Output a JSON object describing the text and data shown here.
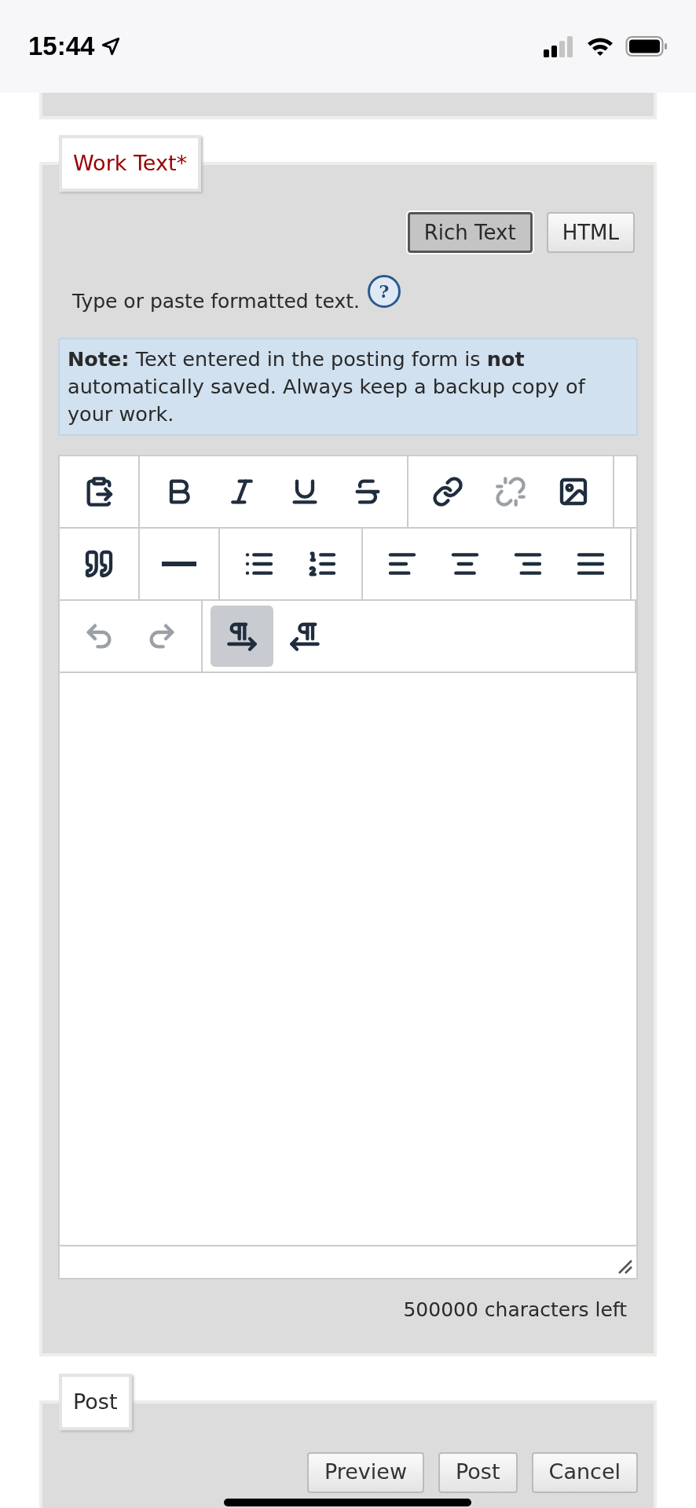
{
  "status_bar": {
    "time": "15:44"
  },
  "work_text": {
    "legend": "Work Text*",
    "modes": [
      {
        "label": "Rich Text",
        "selected": true
      },
      {
        "label": "HTML",
        "selected": false
      }
    ],
    "hint": "Type or paste formatted text.",
    "help": "?",
    "note": "**Note:** Text entered in the posting form is **not** automatically saved. Always keep a backup copy of your work.",
    "toolbar": [
      [
        [
          {
            "kind": "paste",
            "disabled": false
          }
        ],
        [
          {
            "kind": "bold",
            "disabled": false
          },
          {
            "kind": "italic",
            "disabled": false
          },
          {
            "kind": "underline",
            "disabled": false
          },
          {
            "kind": "strike",
            "disabled": false
          }
        ],
        [
          {
            "kind": "link",
            "disabled": false
          },
          {
            "kind": "unlink",
            "disabled": true
          },
          {
            "kind": "image",
            "disabled": false
          }
        ]
      ],
      [
        [
          {
            "kind": "quote",
            "disabled": false
          }
        ],
        [
          {
            "kind": "rule",
            "disabled": false
          }
        ],
        [
          {
            "kind": "bullets",
            "disabled": false
          },
          {
            "kind": "numbers",
            "disabled": false
          }
        ],
        [
          {
            "kind": "align_left",
            "disabled": false
          },
          {
            "kind": "align_center",
            "disabled": false
          },
          {
            "kind": "align_right",
            "disabled": false
          },
          {
            "kind": "justify",
            "disabled": false
          }
        ]
      ],
      [
        [
          {
            "kind": "undo",
            "disabled": true
          },
          {
            "kind": "redo",
            "disabled": true
          }
        ],
        [
          {
            "kind": "ltr",
            "selected": true
          },
          {
            "kind": "rtl",
            "selected": false
          }
        ]
      ]
    ],
    "counter": "500000 characters left"
  },
  "post": {
    "legend": "Post",
    "buttons": [
      "Preview",
      "Post",
      "Cancel"
    ]
  }
}
